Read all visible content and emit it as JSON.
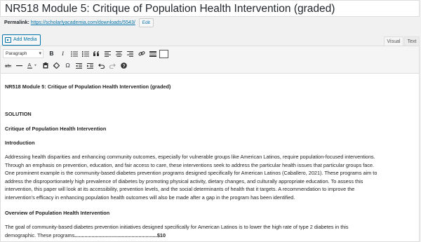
{
  "post": {
    "title": "NR518 Module 5: Critique of Population Health Intervention (graded)"
  },
  "permalink": {
    "label": "Permalink:",
    "url": "https://scholarlyacademia.com/downloads/5543/",
    "edit_label": "Edit"
  },
  "media": {
    "add_label": "Add Media"
  },
  "tabs": {
    "visual": "Visual",
    "text": "Text"
  },
  "toolbar": {
    "format_value": "Paragraph",
    "bold": "B",
    "italic": "I"
  },
  "content": {
    "heading": "NR518 Module 5: Critique of Population Health Intervention (graded)",
    "solution": "SOLUTION",
    "section_title": "Critique of Population Health Intervention",
    "intro_heading": "Introduction",
    "intro_lines": [
      "Addressing health disparities and enhancing community outcomes, especially for vulnerable groups like American Latinos, require population-focused interventions.",
      "Through an emphasis on prevention, education, and fair access to care, these interventions seek to address the particular health issues that particular groups face.",
      "One prominent example is the community-based diabetes prevention programs designed specifically for American Latinos (Caballero, 2021). These programs aim to",
      "address the disproportionately high prevalence of diabetes by promoting physical activity, dietary changes, and culturally appropriate education. To assess this",
      "intervention, this paper will look at its accessibility, prevention levels, and the social determinants of health that it targets. A recommendation to improve the",
      "intervention's efficacy in enhancing population health outcomes will also be made after a gap in the program has been identified."
    ],
    "overview_heading": "Overview of Population Health Intervention",
    "overview_line1": "The goal of community-based diabetes prevention initiatives designed specifically for American Latinos is to lower the high rate of type 2 diabetes in this",
    "overview_line2": "demographic. These programs",
    "dots": "..........................................................",
    "price": "$10"
  }
}
